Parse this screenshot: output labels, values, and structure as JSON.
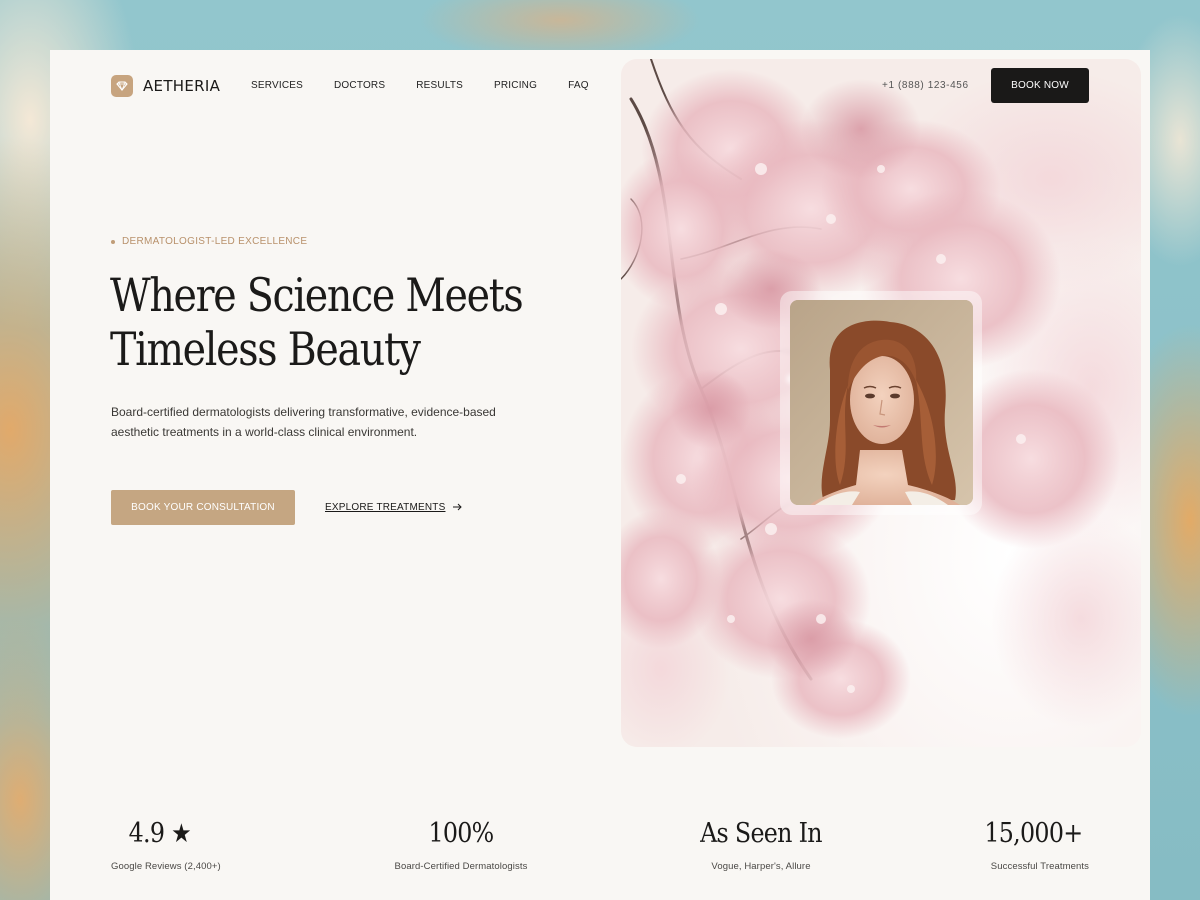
{
  "brand": {
    "name": "AETHERIA",
    "logo_icon": "diamond-icon",
    "accent_color": "#c5a682"
  },
  "nav": {
    "items": [
      {
        "label": "SERVICES"
      },
      {
        "label": "DOCTORS"
      },
      {
        "label": "RESULTS"
      },
      {
        "label": "PRICING"
      },
      {
        "label": "FAQ"
      }
    ]
  },
  "header": {
    "phone": "+1 (888) 123-456",
    "book_now_label": "BOOK NOW"
  },
  "hero": {
    "eyebrow": "DERMATOLOGIST-LED EXCELLENCE",
    "headline_line1": "Where Science Meets",
    "headline_line2": "Timeless Beauty",
    "subtext_line1": "Board-certified dermatologists delivering transformative, evidence-based",
    "subtext_line2": "aesthetic treatments in a world-class clinical environment.",
    "primary_cta": "BOOK YOUR CONSULTATION",
    "secondary_cta": "EXPLORE TREATMENTS",
    "secondary_cta_icon": "arrow-right-icon",
    "image_subject": "cherry-blossom-branch",
    "portrait_subject": "woman-portrait"
  },
  "stats": [
    {
      "value": "4.9",
      "icon": "star-icon",
      "icon_glyph": "★",
      "label": "Google Reviews (2,400+)"
    },
    {
      "value": "100%",
      "label": "Board-Certified Dermatologists"
    },
    {
      "value": "As Seen In",
      "label": "Vogue, Harper's, Allure"
    },
    {
      "value": "15,000+",
      "label": "Successful Treatments"
    }
  ]
}
